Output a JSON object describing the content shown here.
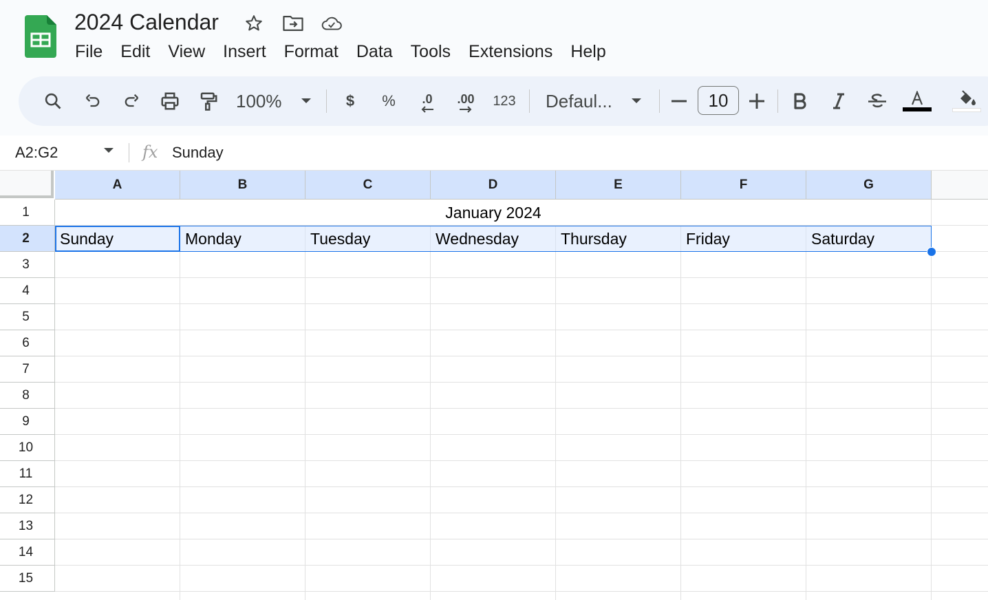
{
  "app": {
    "doc_title": "2024 Calendar",
    "brand_color": "#188038",
    "header_icons": [
      "star-icon",
      "move-folder-icon",
      "cloud-saved-icon"
    ]
  },
  "menu": [
    "File",
    "Edit",
    "View",
    "Insert",
    "Format",
    "Data",
    "Tools",
    "Extensions",
    "Help"
  ],
  "toolbar": {
    "zoom": "100%",
    "currency": "$",
    "percent": "%",
    "decrease_decimal": ".0",
    "increase_decimal": ".00",
    "number_format": "123",
    "font": "Defaul...",
    "font_size": "10",
    "text_color": "#000000",
    "fill_color": "#ffffff"
  },
  "formula_bar": {
    "name_box": "A2:G2",
    "fx": "fx",
    "value": "Sunday"
  },
  "sheet": {
    "columns": [
      "A",
      "B",
      "C",
      "D",
      "E",
      "F",
      "G"
    ],
    "rows": [
      "1",
      "2",
      "3",
      "4",
      "5",
      "6",
      "7",
      "8",
      "9",
      "10",
      "11",
      "12",
      "13",
      "14",
      "15"
    ],
    "selected_row": "2",
    "merged_title": "January 2024",
    "weekdays": [
      "Sunday",
      "Monday",
      "Tuesday",
      "Wednesday",
      "Thursday",
      "Friday",
      "Saturday"
    ],
    "selection_color": "#1a73e8"
  }
}
